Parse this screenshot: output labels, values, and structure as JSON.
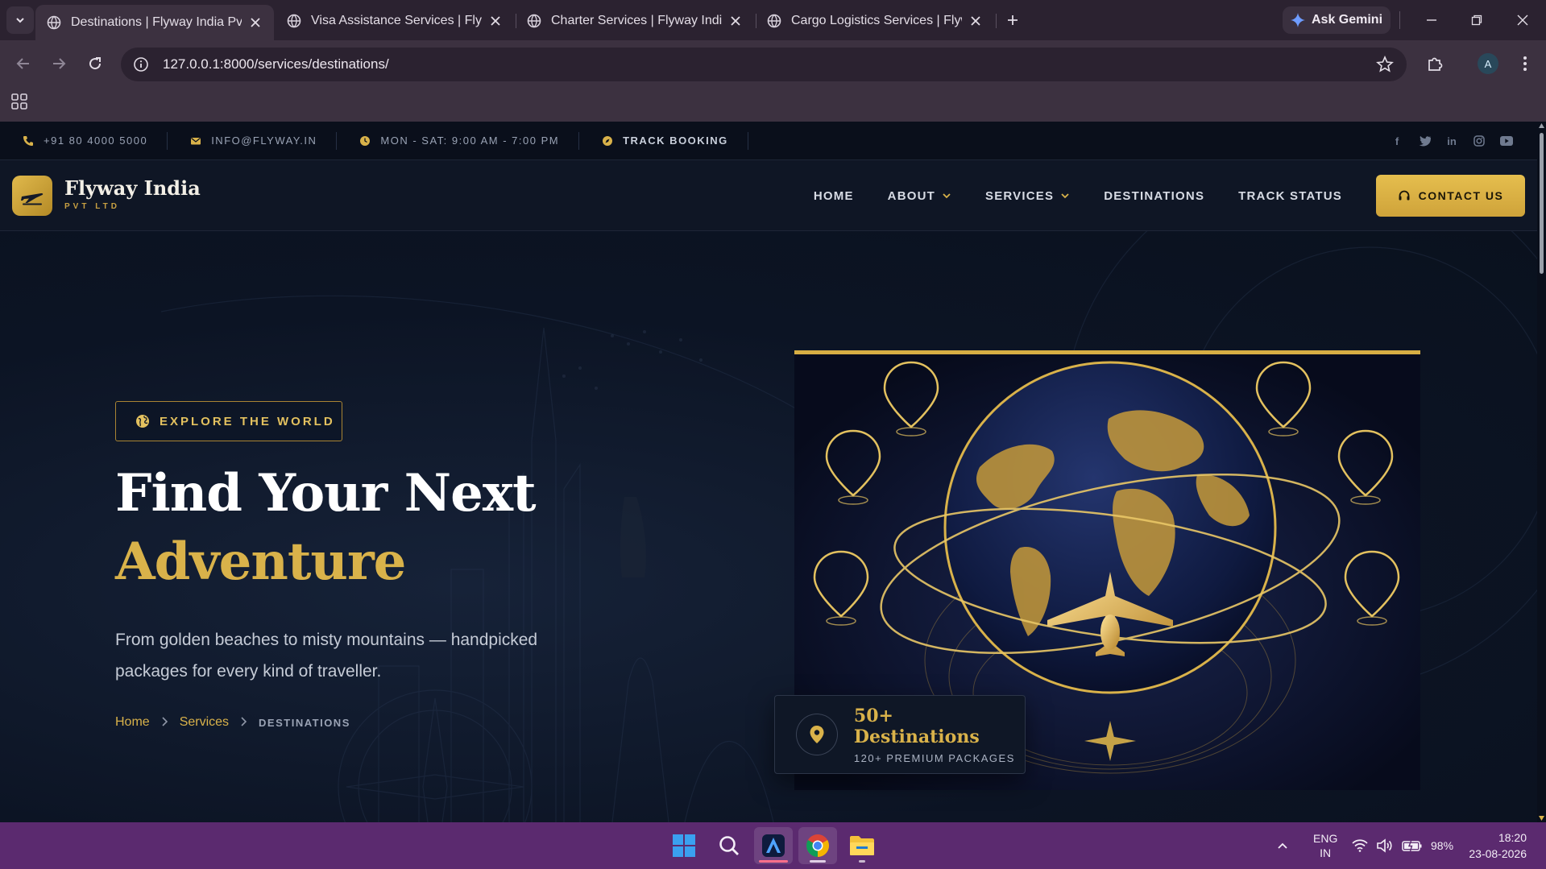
{
  "browser": {
    "tabs": [
      {
        "title": "Destinations | Flyway India Pvt Ltd",
        "active": true
      },
      {
        "title": "Visa Assistance Services | Flyway India",
        "active": false
      },
      {
        "title": "Charter Services | Flyway India Pvt Ltd",
        "active": false
      },
      {
        "title": "Cargo Logistics Services | Flyway India",
        "active": false
      }
    ],
    "gemini_label": "Ask Gemini",
    "url": "127.0.0.1:8000/services/destinations/",
    "profile_initial": "A"
  },
  "topbar": {
    "phone": "+91 80 4000 5000",
    "email": "INFO@FLYWAY.IN",
    "hours": "MON - SAT: 9:00 AM - 7:00 PM",
    "track": "TRACK BOOKING",
    "social_icons": [
      "facebook-icon",
      "twitter-icon",
      "linkedin-icon",
      "instagram-icon",
      "youtube-icon"
    ]
  },
  "nav": {
    "brand": "Flyway India",
    "brand_sub": "PVT LTD",
    "links": [
      "HOME",
      "ABOUT",
      "SERVICES",
      "DESTINATIONS",
      "TRACK STATUS"
    ],
    "contact": "CONTACT US"
  },
  "hero": {
    "eyebrow": "EXPLORE THE WORLD",
    "title_line1": "Find Your Next",
    "title_line2": "Adventure",
    "lead": "From golden beaches to misty mountains — handpicked packages for every kind of traveller.",
    "breadcrumb": {
      "home": "Home",
      "services": "Services",
      "current": "DESTINATIONS"
    },
    "stat_title": "50+ Destinations",
    "stat_sub": "120+ PREMIUM PACKAGES"
  },
  "taskbar": {
    "lang_top": "ENG",
    "lang_bottom": "IN",
    "battery": "98%",
    "time": "18:20",
    "date": "23-08-2026"
  },
  "colors": {
    "gold": "#d9b24a",
    "navy": "#0c1424",
    "chrome_frame": "#2b2230",
    "taskbar": "#5b2a6f"
  }
}
